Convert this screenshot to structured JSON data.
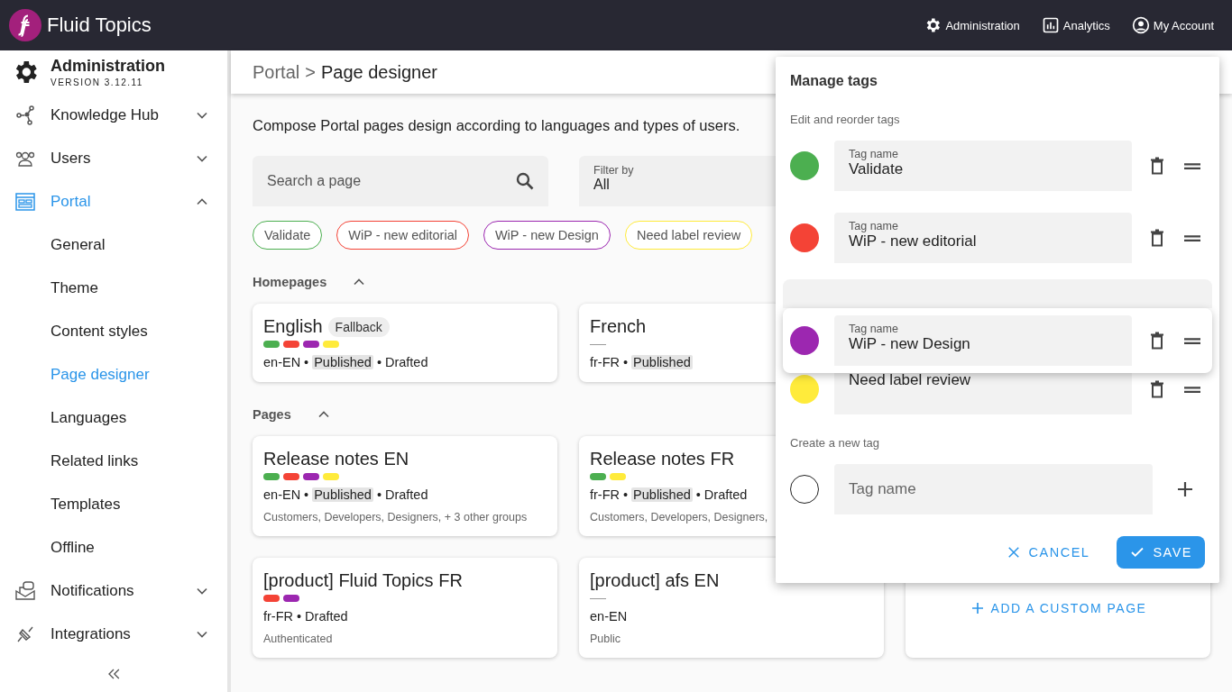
{
  "topbar": {
    "logo": "Fluid Topics",
    "links": [
      {
        "kind": "gear",
        "label": "Administration"
      },
      {
        "kind": "chart",
        "label": "Analytics"
      },
      {
        "kind": "account",
        "label": "My Account"
      }
    ]
  },
  "sidebar": {
    "title": "Administration",
    "version": "VERSION 3.12.11",
    "items": [
      {
        "label": "Knowledge Hub",
        "expanded": false,
        "selected": false
      },
      {
        "label": "Users",
        "expanded": false,
        "selected": false
      },
      {
        "label": "Portal",
        "expanded": true,
        "selected": true,
        "children": [
          {
            "label": "General",
            "selected": false
          },
          {
            "label": "Theme",
            "selected": false
          },
          {
            "label": "Content styles",
            "selected": false
          },
          {
            "label": "Page designer",
            "selected": true
          },
          {
            "label": "Languages",
            "selected": false
          },
          {
            "label": "Related links",
            "selected": false
          },
          {
            "label": "Templates",
            "selected": false
          },
          {
            "label": "Offline",
            "selected": false
          }
        ]
      },
      {
        "label": "Notifications",
        "expanded": false,
        "selected": false
      },
      {
        "label": "Integrations",
        "expanded": false,
        "selected": false
      }
    ]
  },
  "breadcrumb": {
    "parent": "Portal",
    "separator": ">",
    "current": "Page designer"
  },
  "description": "Compose Portal pages design according to languages and types of users.",
  "search": {
    "placeholder": "Search a page"
  },
  "filter": {
    "label": "Filter by",
    "value": "All"
  },
  "tag_filters": [
    {
      "label": "Validate",
      "color": "#4caf50"
    },
    {
      "label": "WiP - new editorial",
      "color": "#f44336"
    },
    {
      "label": "WiP - new Design",
      "color": "#9c27b0"
    },
    {
      "label": "Need label review",
      "color": "#ffeb3b"
    }
  ],
  "separator": "•",
  "sections": [
    {
      "title": "Homepages",
      "expanded": true,
      "cards": [
        {
          "title": "English",
          "badge": "Fallback",
          "tags": [
            {
              "color": "#4caf50"
            },
            {
              "color": "#f44336"
            },
            {
              "color": "#9c27b0"
            },
            {
              "color": "#ffeb3b"
            }
          ],
          "meta": [
            {
              "text": "en-EN",
              "highlighted": false
            },
            {
              "text": "Published",
              "highlighted": true
            },
            {
              "text": "Drafted",
              "highlighted": false
            }
          ]
        },
        {
          "title": "French",
          "meta": [
            {
              "text": "fr-FR",
              "highlighted": false
            },
            {
              "text": "Published",
              "highlighted": true
            }
          ]
        }
      ]
    },
    {
      "title": "Pages",
      "expanded": true,
      "cards": [
        {
          "title": "Release notes EN",
          "tags": [
            {
              "color": "#4caf50"
            },
            {
              "color": "#f44336"
            },
            {
              "color": "#9c27b0"
            },
            {
              "color": "#ffeb3b"
            }
          ],
          "meta": [
            {
              "text": "en-EN",
              "highlighted": false
            },
            {
              "text": "Published",
              "highlighted": true
            },
            {
              "text": "Drafted",
              "highlighted": false
            }
          ],
          "groups": "Customers, Developers, Designers, + 3 other groups"
        },
        {
          "title": "Release notes FR",
          "tags": [
            {
              "color": "#4caf50"
            },
            {
              "color": "#ffeb3b"
            }
          ],
          "meta": [
            {
              "text": "fr-FR",
              "highlighted": false
            },
            {
              "text": "Published",
              "highlighted": true
            },
            {
              "text": "Drafted",
              "highlighted": false
            }
          ],
          "groups": "Customers, Developers, Designers,"
        },
        {
          "kind": "spacer"
        },
        {
          "title": "[product] Fluid Topics FR",
          "tags": [
            {
              "color": "#f44336"
            },
            {
              "color": "#9c27b0"
            }
          ],
          "meta": [
            {
              "text": "fr-FR",
              "highlighted": false
            },
            {
              "text": "Drafted",
              "highlighted": false
            }
          ],
          "groups": "Authenticated"
        },
        {
          "title": "[product] afs EN",
          "meta": [
            {
              "text": "en-EN",
              "highlighted": false
            }
          ],
          "groups": "Public"
        },
        {
          "kind": "add",
          "label": "ADD A CUSTOM PAGE"
        }
      ]
    }
  ],
  "dialog": {
    "title": "Manage tags",
    "edit_label": "Edit and reorder tags",
    "rows": [
      {
        "kind": "row",
        "color": "#4caf50",
        "label": "Tag name",
        "value": "Validate"
      },
      {
        "kind": "row",
        "color": "#f44336",
        "label": "Tag name",
        "value": "WiP - new editorial"
      },
      {
        "kind": "slot"
      },
      {
        "kind": "dragging",
        "color": "#9c27b0",
        "label": "Tag name",
        "value": "WiP - new Design"
      },
      {
        "kind": "row",
        "color": "#ffeb3b",
        "value": "Need label review"
      }
    ],
    "create_label": "Create a new tag",
    "new_tag": {
      "placeholder": "Tag name"
    },
    "buttons": [
      {
        "kind": "cancel",
        "label": "CANCEL"
      },
      {
        "kind": "save",
        "label": "SAVE"
      }
    ]
  }
}
